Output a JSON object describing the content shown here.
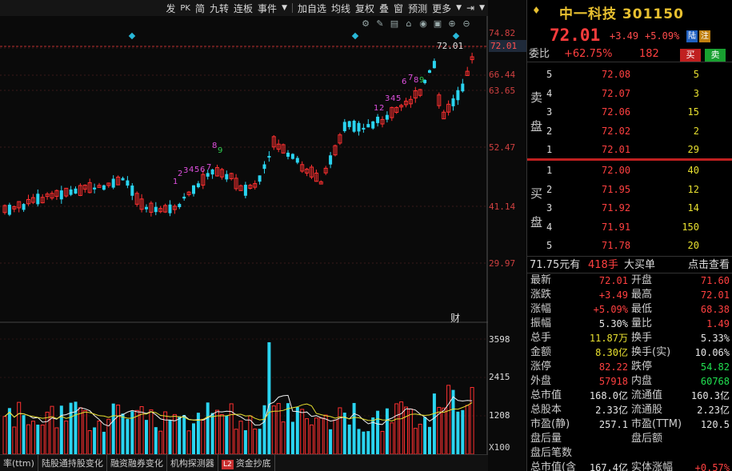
{
  "toolbar": {
    "items": [
      "发",
      "PK",
      "简",
      "九转",
      "连板",
      "事件",
      "加自选",
      "均线",
      "复权",
      "叠",
      "窗",
      "预测",
      "更多"
    ]
  },
  "chart": {
    "price_axis": [
      "74.82",
      "66.44",
      "63.65",
      "52.47",
      "41.14",
      "29.97"
    ],
    "price_tag": "72.01",
    "current_label": "72.01",
    "volume_axis": [
      "3598",
      "2415",
      "1208"
    ],
    "volume_unit": "X100",
    "event_marker": "财",
    "td_labels": [
      "1",
      "2",
      "3",
      "4",
      "5",
      "6",
      "7",
      "8",
      "9",
      "1",
      "2",
      "3",
      "4",
      "5",
      "6",
      "7",
      "8",
      "9"
    ]
  },
  "chart_data": {
    "type": "candlestick",
    "title": "",
    "price_ylim": [
      29.97,
      74.82
    ],
    "volume_ylim": [
      0,
      3598
    ],
    "colors": {
      "up": "#ff3030",
      "down": "#2ad4f0",
      "ma": "#f0f0f0",
      "ma2": "#e8e030"
    }
  },
  "bottom_tabs": [
    "率(ttm)",
    "陆股通持股变化",
    "融资融券变化",
    "机构探测器",
    "资金抄底"
  ],
  "stock": {
    "name": "中一科技",
    "code": "301150",
    "price": "72.01",
    "change": "+3.49",
    "pct": "+5.09%",
    "badge_lu": "陆",
    "badge_zhu": "注"
  },
  "webi": {
    "label": "委比",
    "value": "+62.75%",
    "diff": "182",
    "buy_label": "买",
    "sell_label": "卖"
  },
  "sell_side_label": "卖盘",
  "buy_side_label": "买盘",
  "asks": [
    {
      "idx": "5",
      "price": "72.08",
      "vol": "5"
    },
    {
      "idx": "4",
      "price": "72.07",
      "vol": "3"
    },
    {
      "idx": "3",
      "price": "72.06",
      "vol": "15"
    },
    {
      "idx": "2",
      "price": "72.02",
      "vol": "2"
    },
    {
      "idx": "1",
      "price": "72.01",
      "vol": "29"
    }
  ],
  "bids": [
    {
      "idx": "1",
      "price": "72.00",
      "vol": "40"
    },
    {
      "idx": "2",
      "price": "71.95",
      "vol": "12"
    },
    {
      "idx": "3",
      "price": "71.92",
      "vol": "14"
    },
    {
      "idx": "4",
      "price": "71.91",
      "vol": "150"
    },
    {
      "idx": "5",
      "price": "71.78",
      "vol": "20"
    }
  ],
  "bigbuy": {
    "price": "71.75元有",
    "qty": "418手",
    "label": "大买单",
    "link": "点击查看"
  },
  "quote": [
    {
      "l1": "最新",
      "v1": "72.01",
      "c1": "red",
      "l2": "开盘",
      "v2": "71.60",
      "c2": "red"
    },
    {
      "l1": "涨跌",
      "v1": "+3.49",
      "c1": "red",
      "l2": "最高",
      "v2": "72.01",
      "c2": "red"
    },
    {
      "l1": "涨幅",
      "v1": "+5.09%",
      "c1": "red",
      "l2": "最低",
      "v2": "68.38",
      "c2": "red"
    },
    {
      "l1": "振幅",
      "v1": "5.30%",
      "c1": "white",
      "l2": "量比",
      "v2": "1.49",
      "c2": "red"
    },
    {
      "l1": "总手",
      "v1": "11.87万",
      "c1": "yellow",
      "l2": "换手",
      "v2": "5.33%",
      "c2": "white"
    },
    {
      "l1": "金额",
      "v1": "8.30亿",
      "c1": "yellow",
      "l2": "换手(实)",
      "v2": "10.06%",
      "c2": "white"
    },
    {
      "l1": "涨停",
      "v1": "82.22",
      "c1": "red",
      "l2": "跌停",
      "v2": "54.82",
      "c2": "green"
    },
    {
      "l1": "外盘",
      "v1": "57918",
      "c1": "red",
      "l2": "内盘",
      "v2": "60768",
      "c2": "green"
    },
    {
      "l1": "总市值",
      "v1": "168.0亿",
      "c1": "white",
      "l2": "流通值",
      "v2": "160.3亿",
      "c2": "white"
    },
    {
      "l1": "总股本",
      "v1": "2.33亿",
      "c1": "white",
      "l2": "流通股",
      "v2": "2.23亿",
      "c2": "white"
    },
    {
      "l1": "市盈(静)",
      "v1": "257.1",
      "c1": "white",
      "l2": "市盈(TTM)",
      "v2": "120.5",
      "c2": "white"
    },
    {
      "l1": "盘后量",
      "v1": "",
      "c1": "white",
      "l2": "盘后额",
      "v2": "",
      "c2": "white"
    },
    {
      "l1": "盘后笔数",
      "v1": "",
      "c1": "white",
      "l2": "",
      "v2": "",
      "c2": "white"
    },
    {
      "l1": "总市值(含",
      "v1": "167.4亿",
      "c1": "white",
      "l2": "实体涨幅",
      "v2": "+0.57%",
      "c2": "red"
    }
  ]
}
